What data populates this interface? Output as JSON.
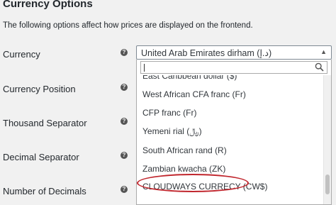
{
  "section": {
    "title": "Currency Options",
    "description": "The following options affect how prices are displayed on the frontend."
  },
  "fields": [
    {
      "label": "Currency",
      "help_icon": "question-circle-icon"
    },
    {
      "label": "Currency Position",
      "help_icon": "question-circle-icon"
    },
    {
      "label": "Thousand Separator",
      "help_icon": "question-circle-icon"
    },
    {
      "label": "Decimal Separator",
      "help_icon": "question-circle-icon"
    },
    {
      "label": "Number of Decimals",
      "help_icon": "question-circle-icon"
    }
  ],
  "currency_select": {
    "selected_value": "United Arab Emirates dirham (د.إ)",
    "search_placeholder": "",
    "options": [
      "East Caribbean dollar ($)",
      "West African CFA franc (Fr)",
      "CFP franc (Fr)",
      "Yemeni rial (﷼)",
      "South African rand (R)",
      "Zambian kwacha (ZK)",
      "CLOUDWAYS CURRECY (CW$)"
    ],
    "highlighted_option": "CLOUDWAYS CURRECY (CW$)"
  },
  "colors": {
    "highlight_ring": "#c0262d",
    "background": "#f1f1f1"
  }
}
